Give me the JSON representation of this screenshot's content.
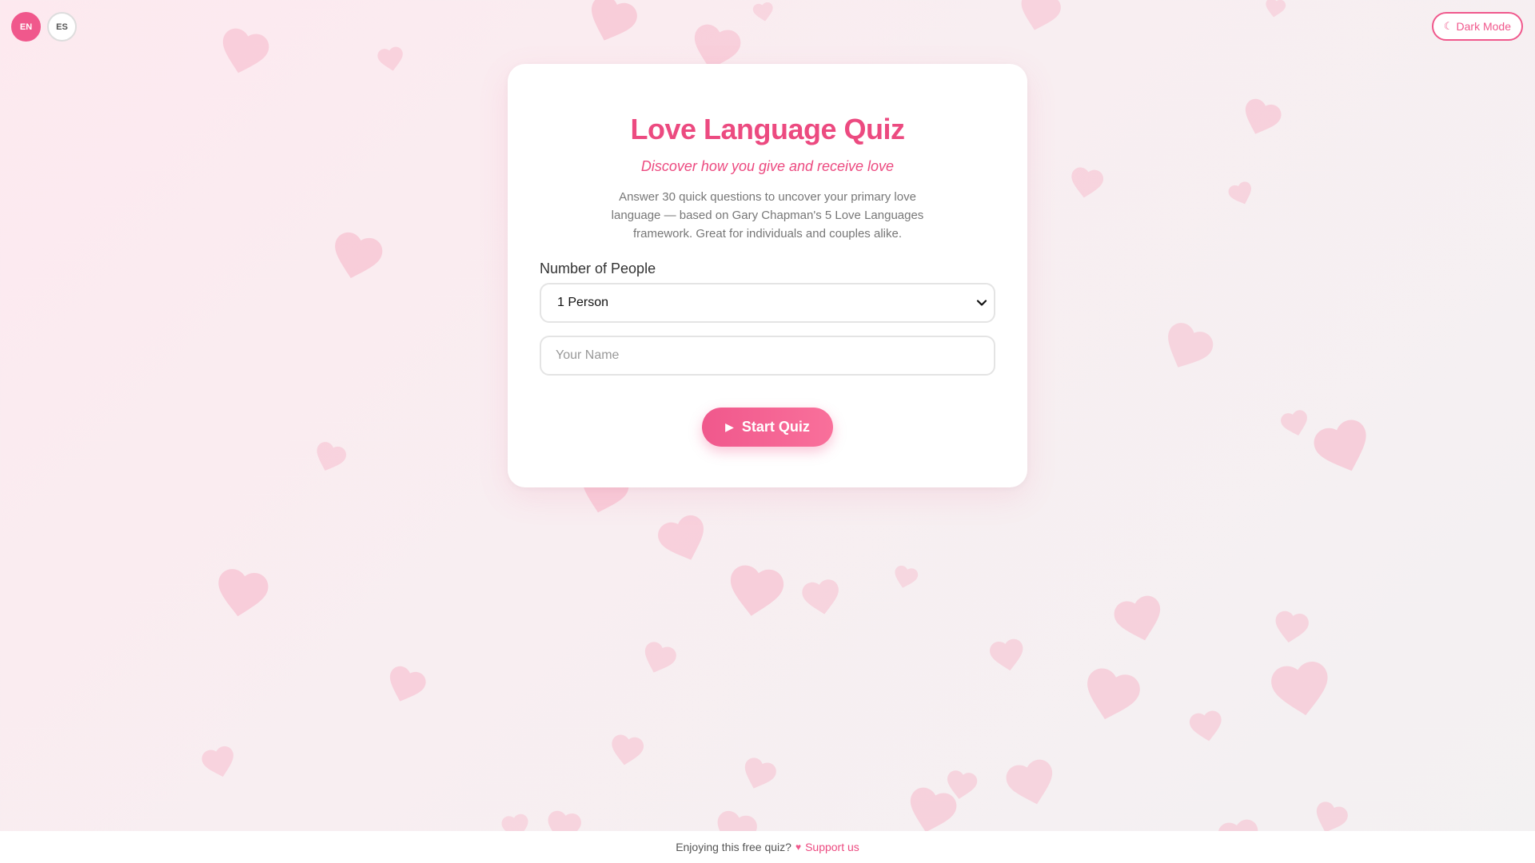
{
  "language_switcher": {
    "options": [
      {
        "label": "EN",
        "active": true
      },
      {
        "label": "ES",
        "active": false
      }
    ]
  },
  "theme_toggle": {
    "label": "Dark Mode",
    "icon": "moon-icon"
  },
  "card": {
    "title": "Love Language Quiz",
    "subtitle": "Discover how you give and receive love",
    "description": "Answer 30 quick questions to uncover your primary love language — based on Gary Chapman's 5 Love Languages framework. Great for individuals and couples alike.",
    "people_label": "Number of People",
    "people_select": {
      "selected": "1 Person"
    },
    "name_input": {
      "placeholder": "Your Name",
      "value": ""
    },
    "start_button": {
      "label": "Start Quiz",
      "icon": "play-icon"
    }
  },
  "footer": {
    "text": "Enjoying this free quiz?",
    "icon": "heart-icon",
    "link_label": "Support us"
  },
  "colors": {
    "accent": "#f0588c",
    "heart_decor": "#f8b4c8",
    "background": "#fde9ef"
  }
}
